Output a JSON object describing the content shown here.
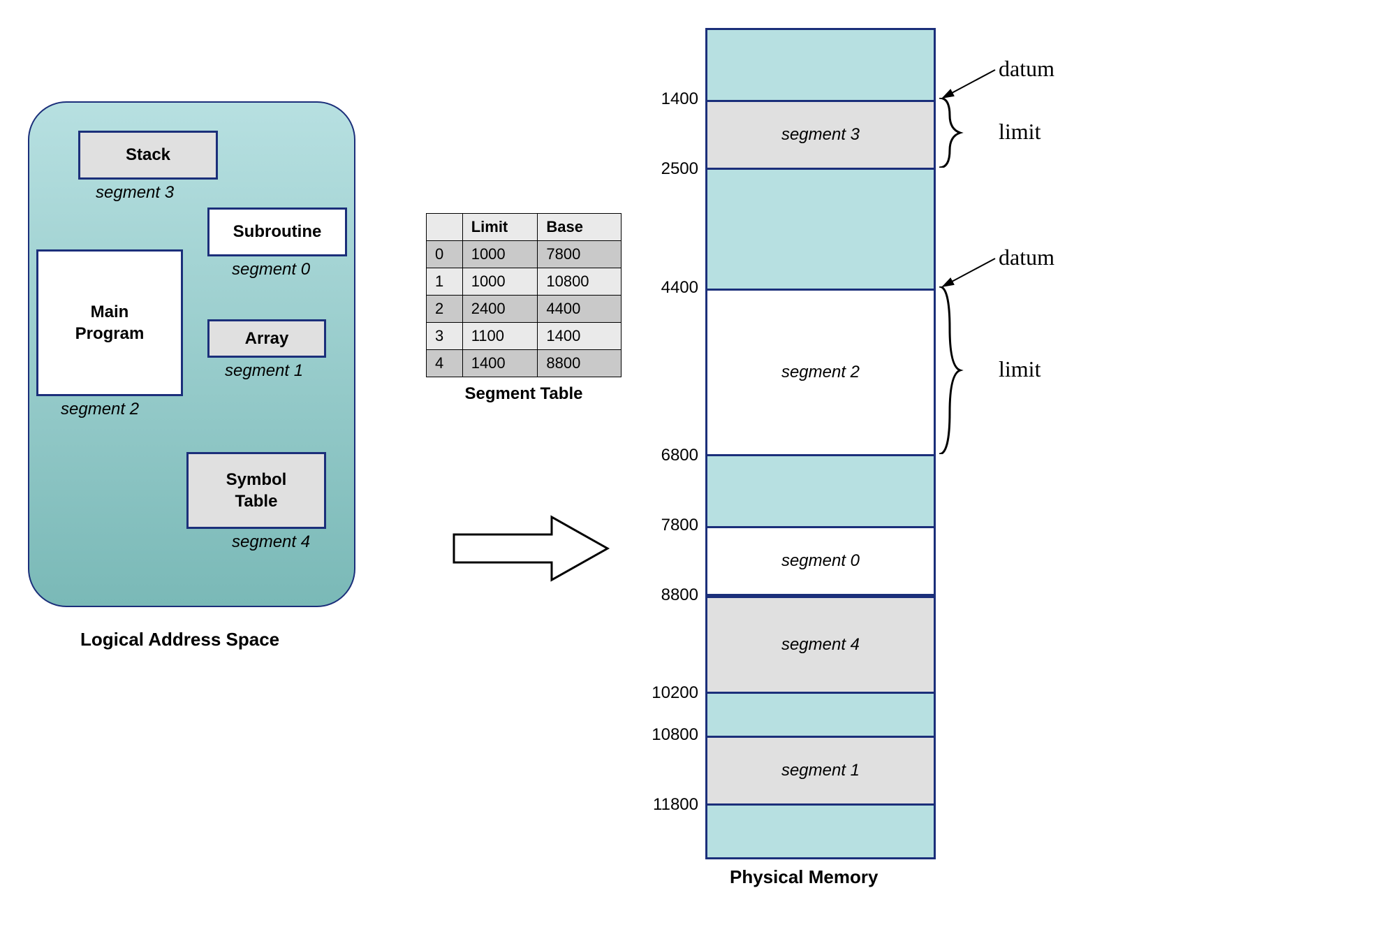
{
  "logical": {
    "title": "Logical Address Space",
    "segments": [
      {
        "name": "Stack",
        "label": "segment 3"
      },
      {
        "name": "Subroutine",
        "label": "segment 0"
      },
      {
        "name": "Main Program",
        "label": "segment 2"
      },
      {
        "name": "Array",
        "label": "segment 1"
      },
      {
        "name": "Symbol Table",
        "label": "segment 4"
      }
    ]
  },
  "segment_table": {
    "caption": "Segment Table",
    "headers": [
      "",
      "Limit",
      "Base"
    ],
    "rows": [
      [
        "0",
        "1000",
        "7800"
      ],
      [
        "1",
        "1000",
        "10800"
      ],
      [
        "2",
        "2400",
        "4400"
      ],
      [
        "3",
        "1100",
        "1400"
      ],
      [
        "4",
        "1400",
        "8800"
      ]
    ]
  },
  "physical_memory": {
    "title": "Physical Memory",
    "ticks": [
      "1400",
      "2500",
      "4400",
      "6800",
      "7800",
      "8800",
      "10200",
      "10800",
      "11800"
    ],
    "slots": [
      {
        "label": "segment 3"
      },
      {
        "label": "segment 2"
      },
      {
        "label": "segment 0"
      },
      {
        "label": "segment 4"
      },
      {
        "label": "segment 1"
      }
    ]
  },
  "annotations": {
    "datum1": "datum",
    "limit1": "limit",
    "datum2": "datum",
    "limit2": "limit"
  },
  "chart_data": {
    "type": "table",
    "title": "Segmentation: Logical Address Space → Segment Table → Physical Memory",
    "segment_table": [
      {
        "segment": 0,
        "limit": 1000,
        "base": 7800
      },
      {
        "segment": 1,
        "limit": 1000,
        "base": 10800
      },
      {
        "segment": 2,
        "limit": 2400,
        "base": 4400
      },
      {
        "segment": 3,
        "limit": 1100,
        "base": 1400
      },
      {
        "segment": 4,
        "limit": 1400,
        "base": 8800
      }
    ],
    "logical_segments": [
      {
        "segment": 0,
        "name": "Subroutine"
      },
      {
        "segment": 1,
        "name": "Array"
      },
      {
        "segment": 2,
        "name": "Main Program"
      },
      {
        "segment": 3,
        "name": "Stack"
      },
      {
        "segment": 4,
        "name": "Symbol Table"
      }
    ],
    "physical_memory_ranges": [
      {
        "from": 1400,
        "to": 2500,
        "segment": 3
      },
      {
        "from": 4400,
        "to": 6800,
        "segment": 2
      },
      {
        "from": 7800,
        "to": 8800,
        "segment": 0
      },
      {
        "from": 8800,
        "to": 10200,
        "segment": 4
      },
      {
        "from": 10800,
        "to": 11800,
        "segment": 1
      }
    ]
  }
}
